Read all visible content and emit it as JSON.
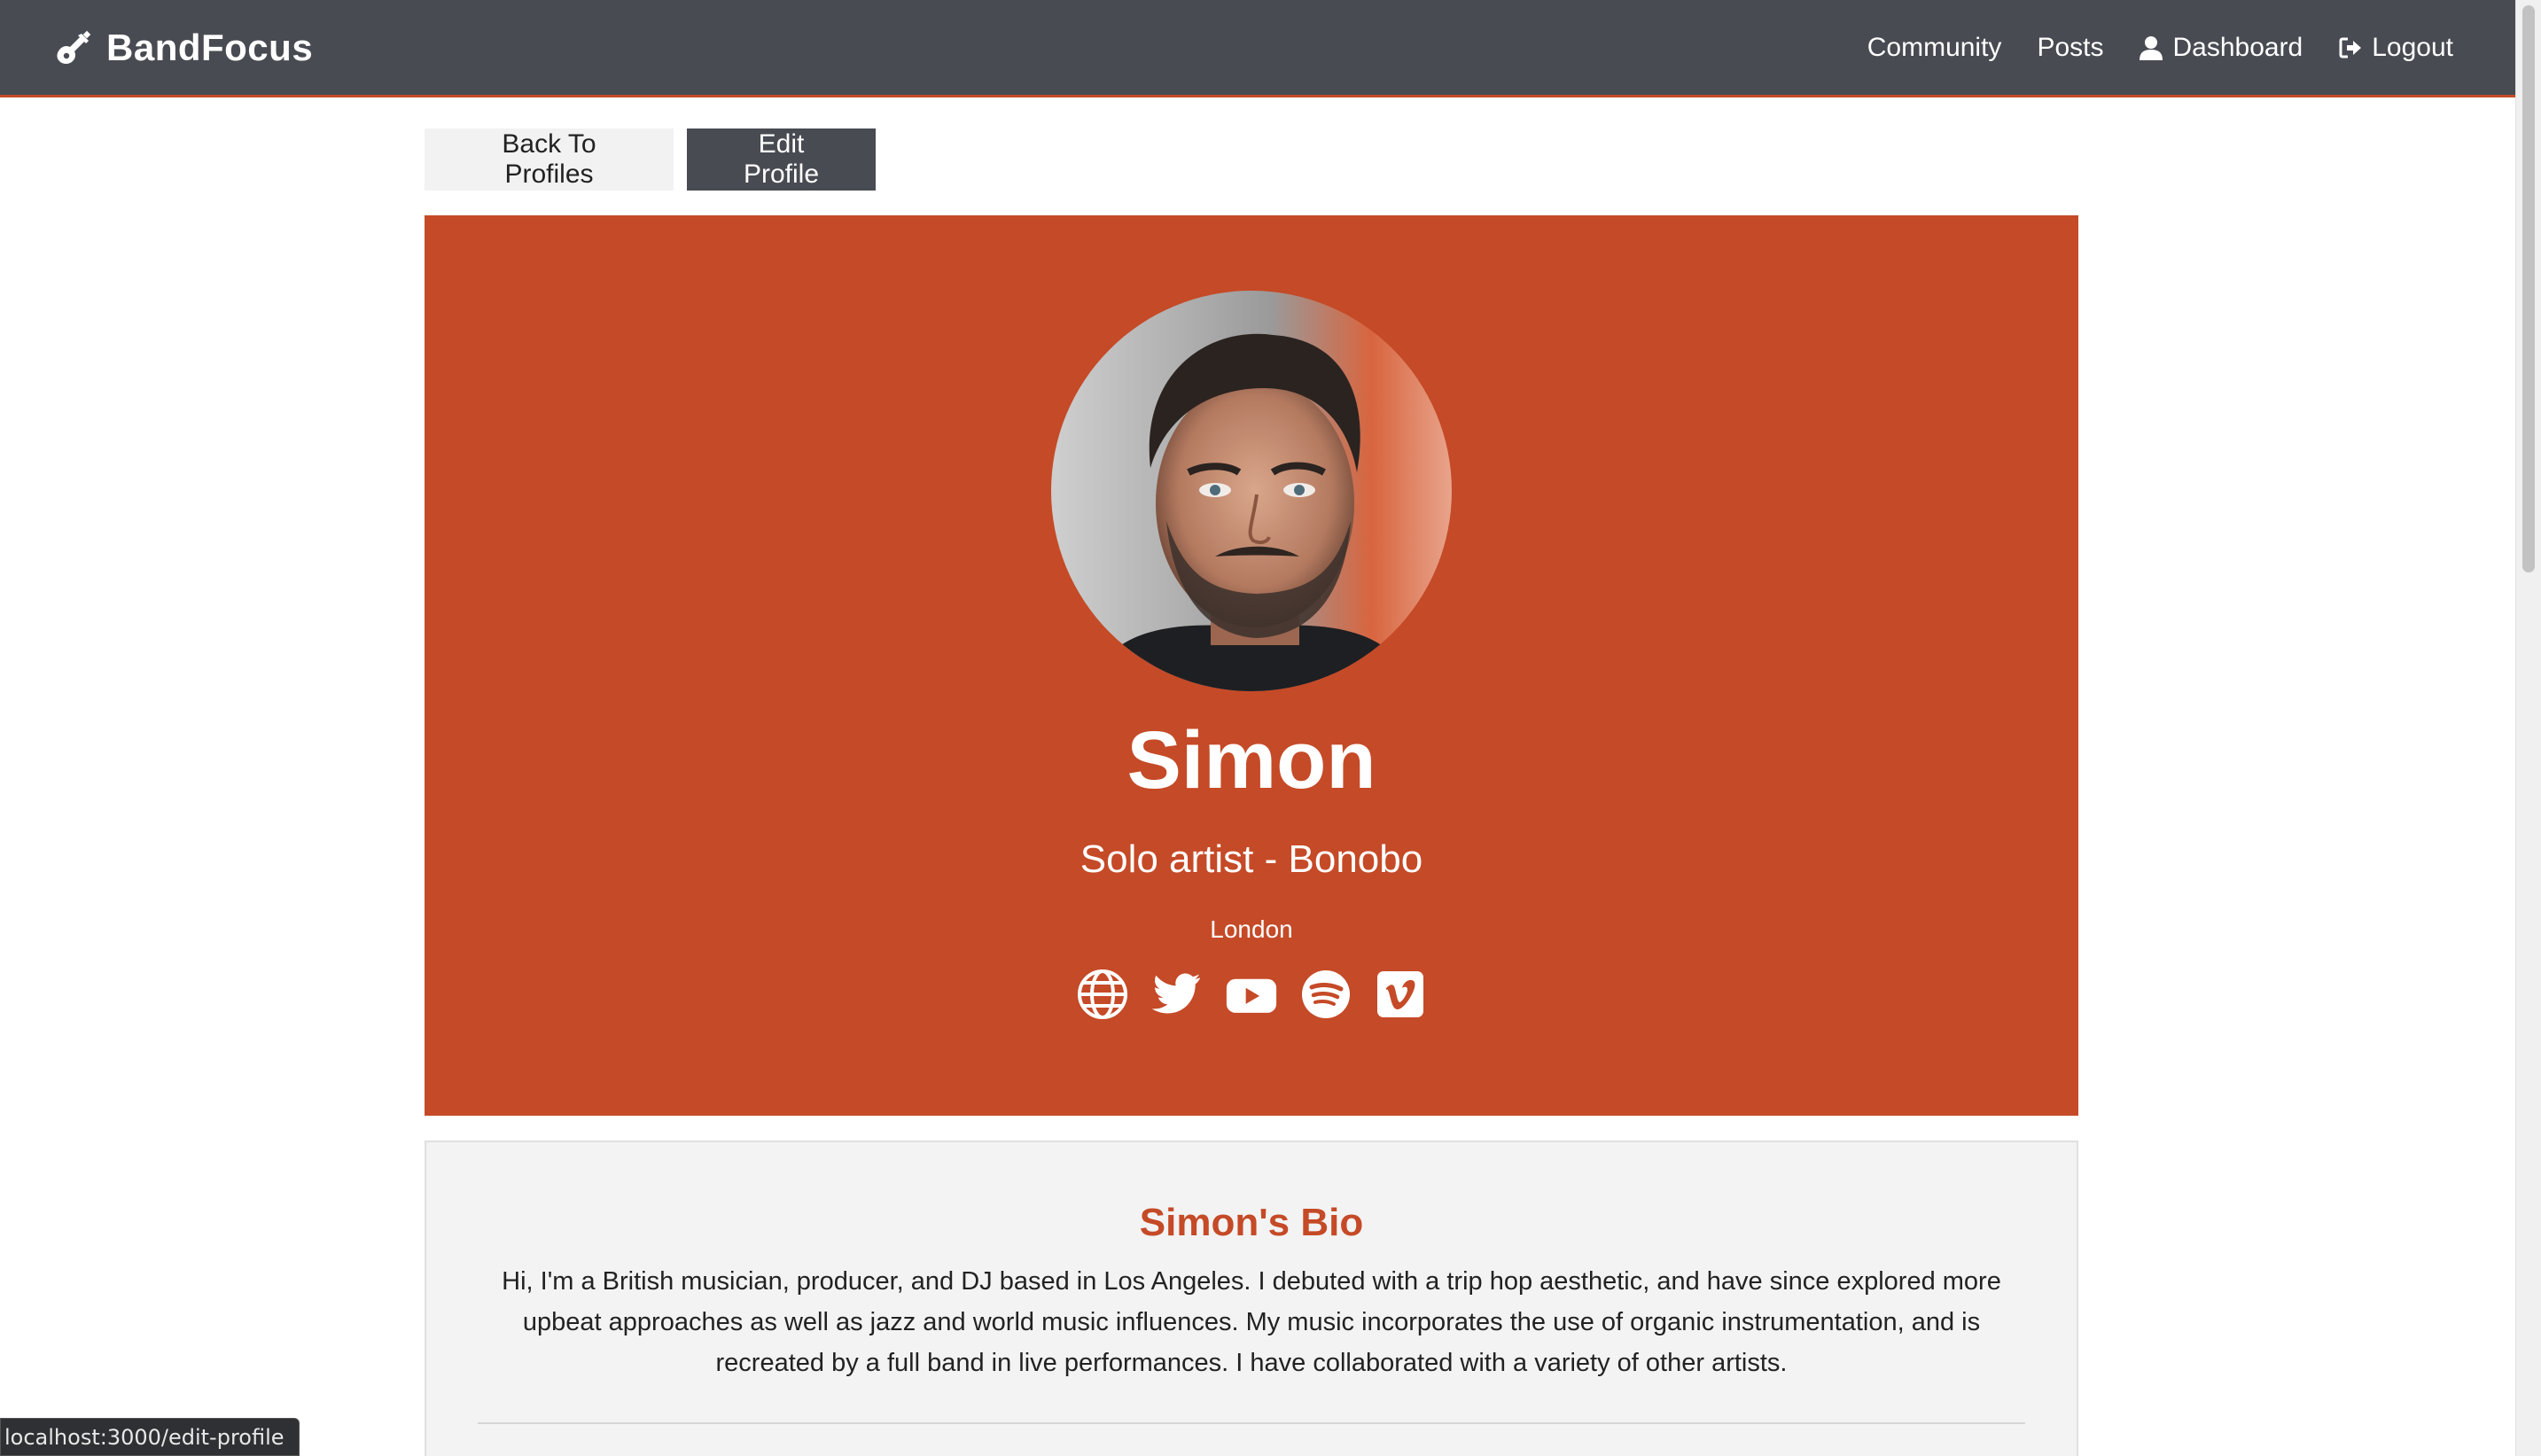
{
  "navbar": {
    "brand": "BandFocus",
    "brand_icon": "guitar-icon",
    "links": [
      {
        "label": "Community",
        "icon": ""
      },
      {
        "label": "Posts",
        "icon": ""
      },
      {
        "label": "Dashboard",
        "icon": "user-icon"
      },
      {
        "label": "Logout",
        "icon": "sign-out-icon"
      }
    ],
    "background_color": "#484b52",
    "accent_color": "#c44b28"
  },
  "actions": {
    "back_label": "Back To Profiles",
    "edit_label": "Edit Profile"
  },
  "profile": {
    "name": "Simon",
    "status": "Solo artist - Bonobo",
    "location": "London",
    "background_color": "#c54a27",
    "social_icons": [
      "globe-icon",
      "twitter-icon",
      "youtube-icon",
      "spotify-icon",
      "vimeo-icon"
    ]
  },
  "bio": {
    "title": "Simon's Bio",
    "text": "Hi, I'm a British musician, producer, and DJ based in Los Angeles. I debuted with a trip hop aesthetic, and have since explored more upbeat approaches as well as jazz and world music influences. My music incorporates the use of organic instrumentation, and is recreated by a full band in live performances. I have collaborated with a variety of other artists."
  },
  "status_bar": {
    "url": "localhost:3000/edit-profile"
  }
}
